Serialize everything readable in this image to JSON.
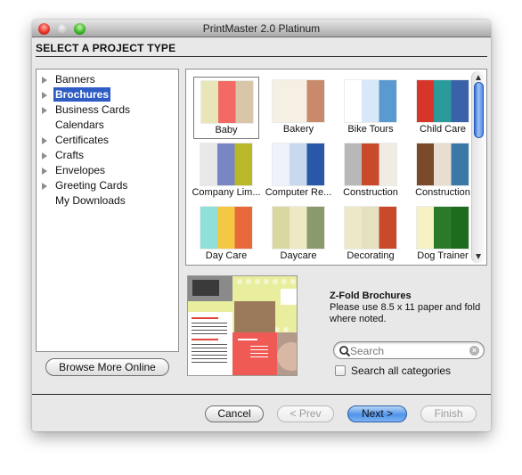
{
  "window": {
    "title": "PrintMaster 2.0 Platinum",
    "section_heading": "SELECT A PROJECT TYPE"
  },
  "categories": [
    {
      "label": "Banners",
      "expandable": true,
      "selected": false
    },
    {
      "label": "Brochures",
      "expandable": true,
      "selected": true
    },
    {
      "label": "Business Cards",
      "expandable": true,
      "selected": false
    },
    {
      "label": "Calendars",
      "expandable": false,
      "selected": false
    },
    {
      "label": "Certificates",
      "expandable": true,
      "selected": false
    },
    {
      "label": "Crafts",
      "expandable": true,
      "selected": false
    },
    {
      "label": "Envelopes",
      "expandable": true,
      "selected": false
    },
    {
      "label": "Greeting Cards",
      "expandable": true,
      "selected": false
    },
    {
      "label": "My Downloads",
      "expandable": false,
      "selected": false
    }
  ],
  "browse_button": "Browse More Online",
  "templates": [
    {
      "label": "Baby",
      "selected": true,
      "colors": [
        "#e8e6b8",
        "#f26a63",
        "#d9c6a8"
      ]
    },
    {
      "label": "Bakery",
      "selected": false,
      "colors": [
        "#f6efe4",
        "#f6efe4",
        "#c88a6a"
      ]
    },
    {
      "label": "Bike Tours",
      "selected": false,
      "colors": [
        "#ffffff",
        "#d7e8f8",
        "#5a9ad0"
      ]
    },
    {
      "label": "Child Care",
      "selected": false,
      "colors": [
        "#d8352a",
        "#2a9a9a",
        "#3a62a8"
      ]
    },
    {
      "label": "Company Lim...",
      "selected": false,
      "colors": [
        "#e8e8e8",
        "#7a86c4",
        "#b8b828"
      ]
    },
    {
      "label": "Computer Re...",
      "selected": false,
      "colors": [
        "#eef2fa",
        "#c8d8ee",
        "#2a58a8"
      ]
    },
    {
      "label": "Construction",
      "selected": false,
      "colors": [
        "#b8b8b8",
        "#c84a2a",
        "#f0ece4"
      ]
    },
    {
      "label": "Construction",
      "selected": false,
      "colors": [
        "#7a4a2a",
        "#e8ddd0",
        "#3a78a8"
      ]
    },
    {
      "label": "Day Care",
      "selected": false,
      "colors": [
        "#8ee0d8",
        "#f4c842",
        "#e86a3a"
      ]
    },
    {
      "label": "Daycare",
      "selected": false,
      "colors": [
        "#d8d8a0",
        "#efe8c4",
        "#8a9a6a"
      ]
    },
    {
      "label": "Decorating",
      "selected": false,
      "colors": [
        "#ece8c8",
        "#e4e0c0",
        "#c84a2a"
      ]
    },
    {
      "label": "Dog Trainer",
      "selected": false,
      "colors": [
        "#f6f2c4",
        "#2a7a2a",
        "#1e6a1e"
      ]
    }
  ],
  "description": {
    "title": "Z-Fold Brochures",
    "body": "Please use 8.5 x 11 paper and fold where noted."
  },
  "search": {
    "placeholder": "Search",
    "value": ""
  },
  "search_all": {
    "label": "Search all categories",
    "checked": false
  },
  "buttons": {
    "cancel": "Cancel",
    "prev": "< Prev",
    "next": "Next >",
    "finish": "Finish"
  },
  "scroll": {
    "position_fraction": 0.0,
    "visible_fraction": 0.3
  }
}
